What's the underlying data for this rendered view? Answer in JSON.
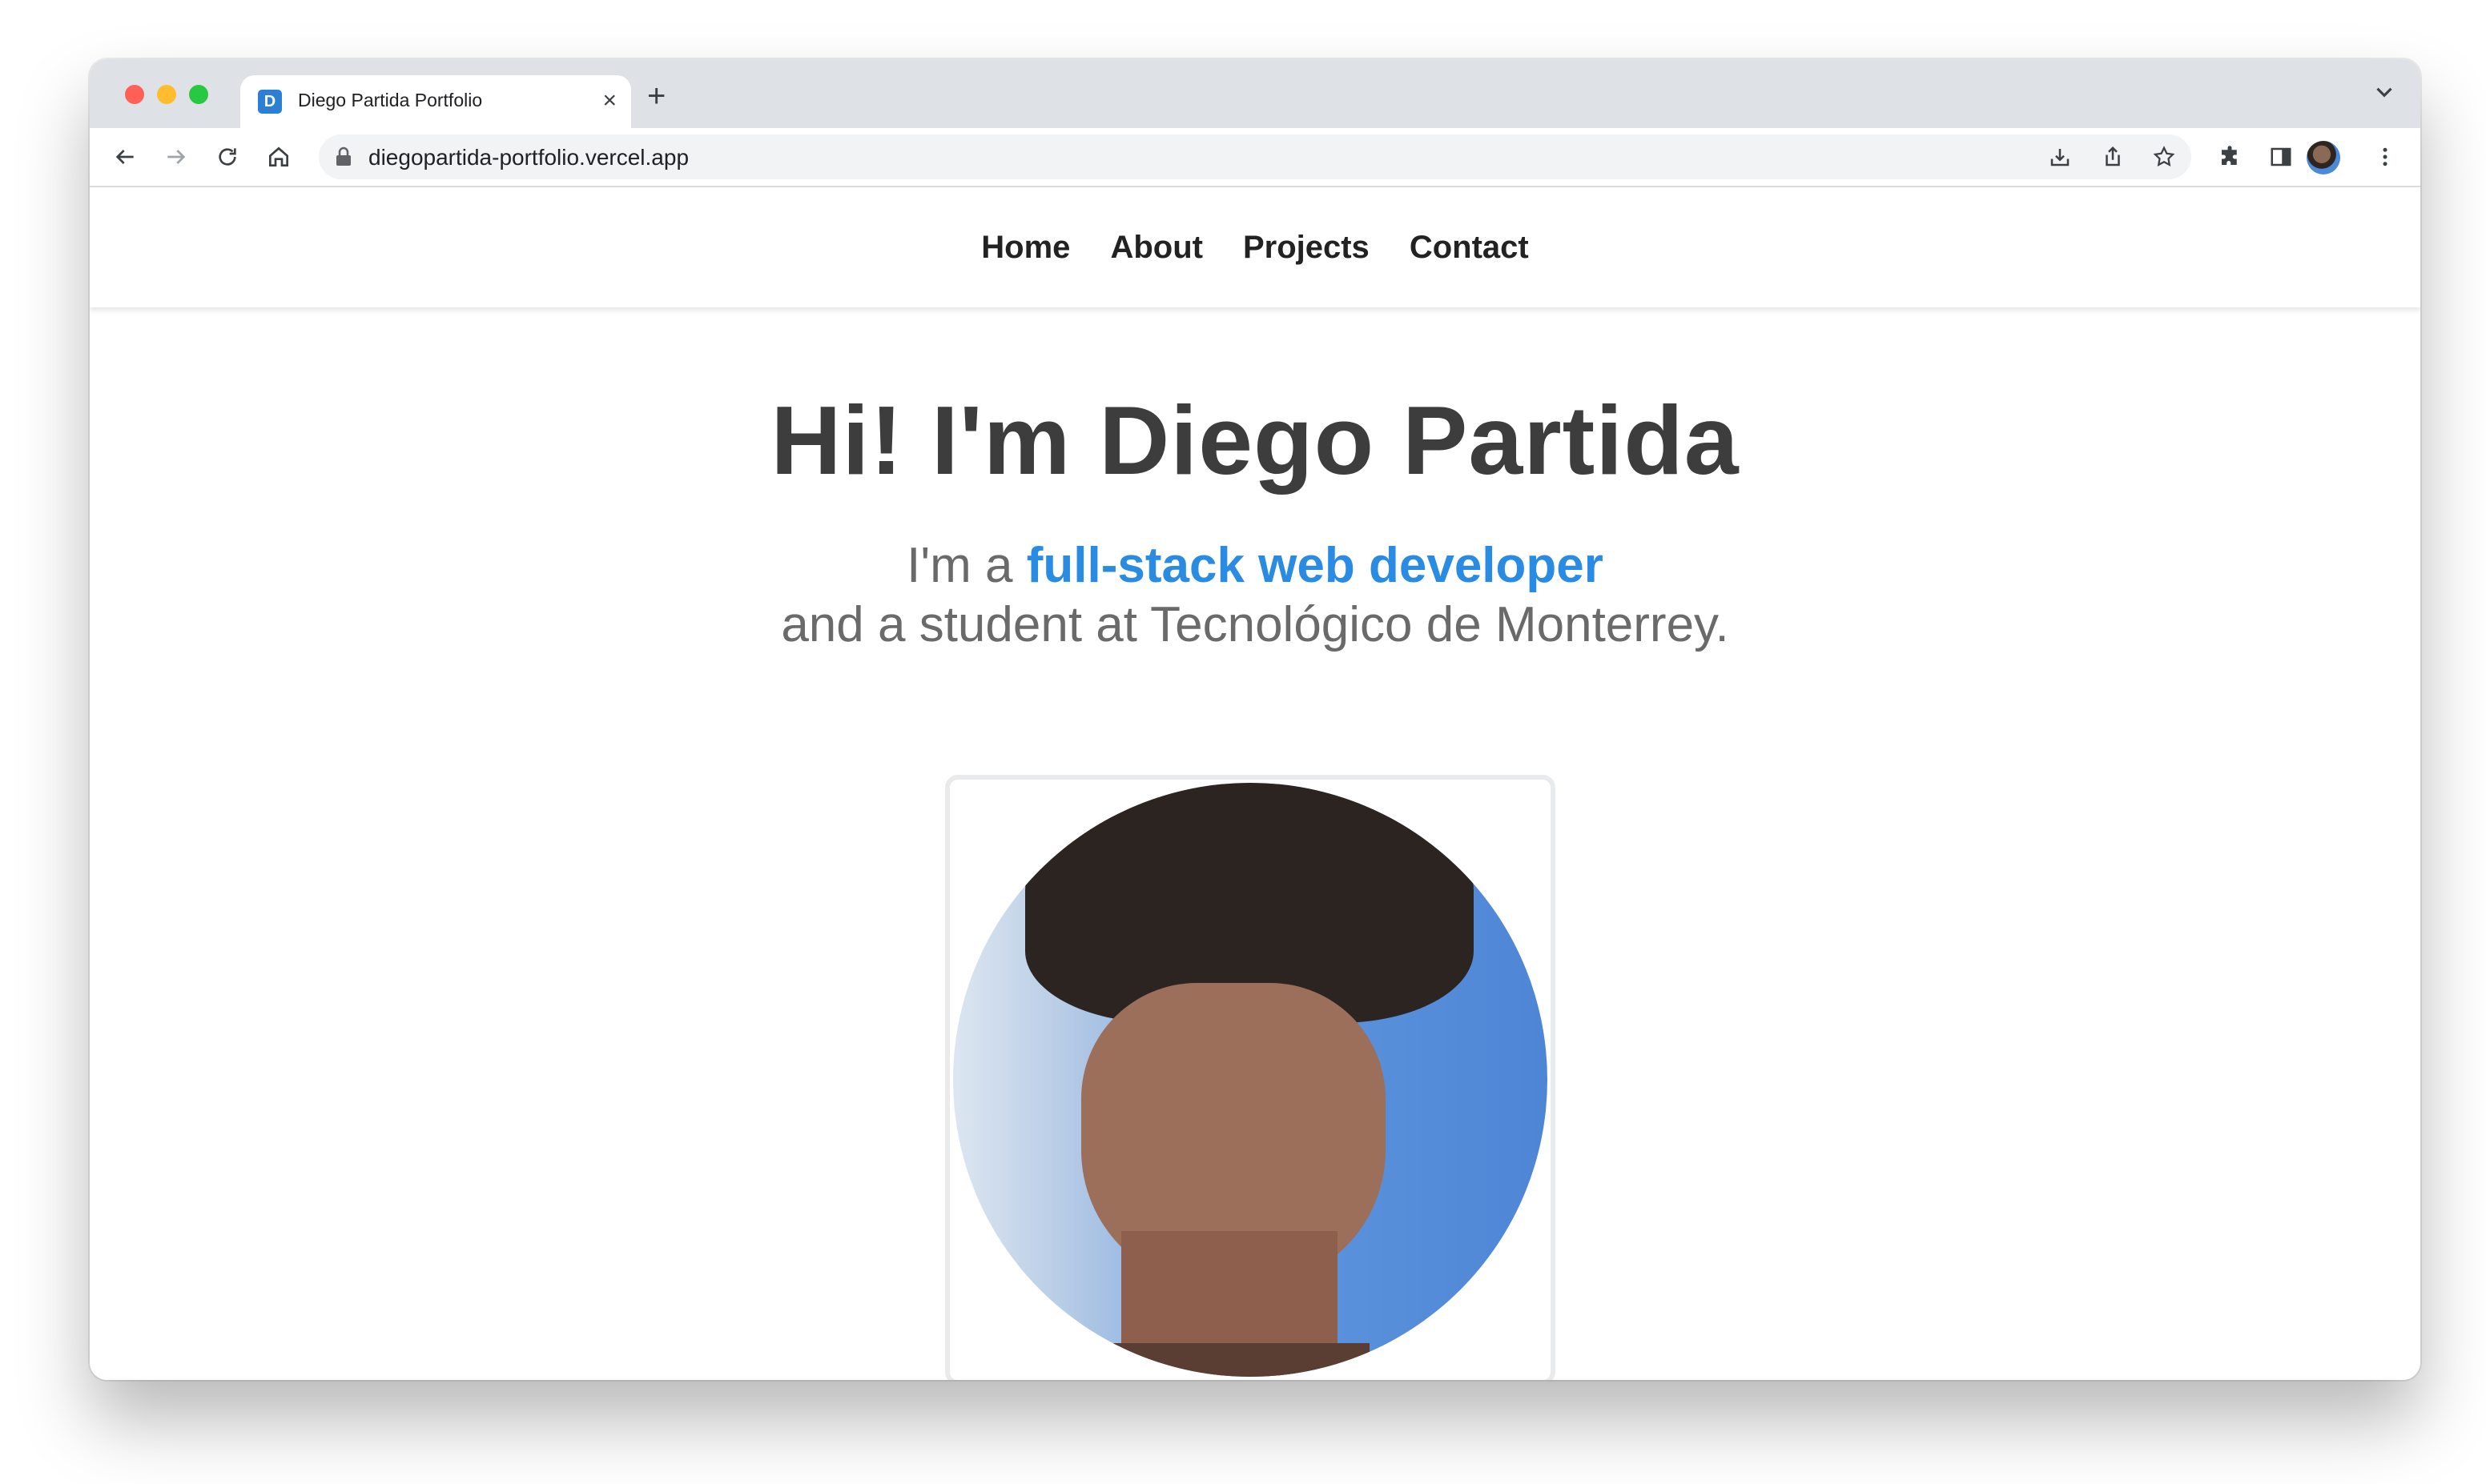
{
  "browser": {
    "tab": {
      "favicon_letter": "D",
      "title": "Diego Partida Portfolio"
    },
    "new_tab_label": "+",
    "url": "diegopartida-portfolio.vercel.app"
  },
  "nav": {
    "items": [
      "Home",
      "About",
      "Projects",
      "Contact"
    ]
  },
  "hero": {
    "title": "Hi! I'm Diego Partida",
    "subtitle_prefix": "I'm a ",
    "subtitle_highlight": "full-stack web developer",
    "subtitle_line2": "and a student at Tecnológico de Monterrey."
  },
  "colors": {
    "accent": "#2a8be3",
    "heading": "#3d3d3d",
    "subtitle": "#6a6a6a"
  }
}
